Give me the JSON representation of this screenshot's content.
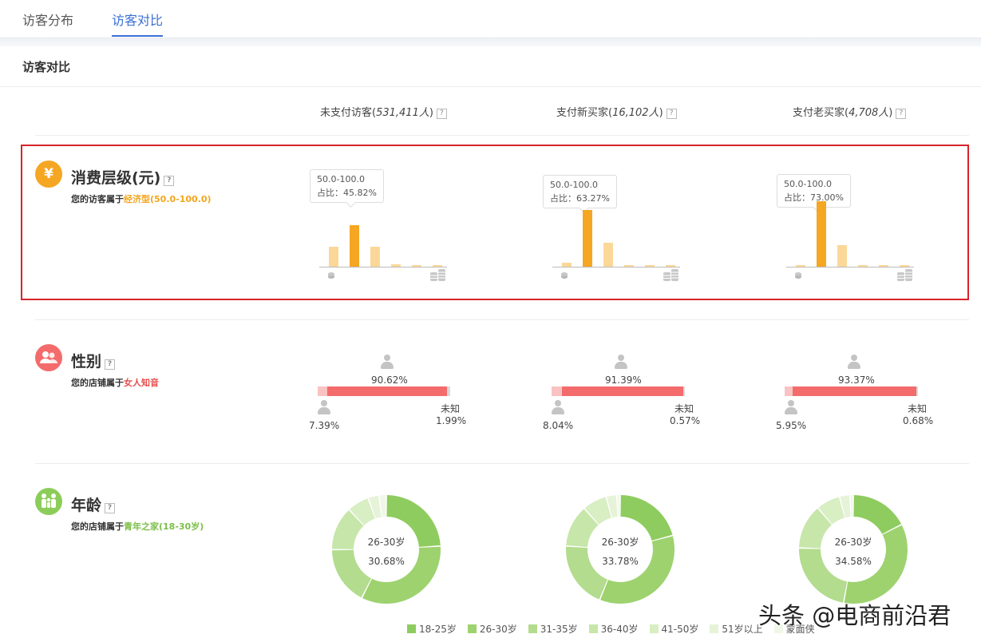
{
  "tabs": [
    {
      "label": "访客分布",
      "active": false
    },
    {
      "label": "访客对比",
      "active": true
    }
  ],
  "section_title": "访客对比",
  "columns": [
    {
      "label": "未支付访客(",
      "count": "531,411人",
      "close": ")"
    },
    {
      "label": "支付新买家(",
      "count": "16,102人",
      "close": ")"
    },
    {
      "label": "支付老买家(",
      "count": "4,708人",
      "close": ")"
    }
  ],
  "help_icon": "?",
  "consumption": {
    "icon": "¥",
    "title": "消费层级(元)",
    "desc_prefix": "您的访客属于",
    "desc_highlight": "经济型(50.0-100.0)",
    "charts": [
      {
        "tooltip_range": "50.0-100.0",
        "tooltip_share": "占比：45.82%",
        "values": [
          0.22,
          0.4582,
          0.22,
          0.03,
          0.01,
          0.01
        ]
      },
      {
        "tooltip_range": "50.0-100.0",
        "tooltip_share": "占比：63.27%",
        "values": [
          0.04,
          0.6327,
          0.27,
          0.02,
          0.01,
          0.01
        ]
      },
      {
        "tooltip_range": "50.0-100.0",
        "tooltip_share": "占比：73.00%",
        "values": [
          0.02,
          0.73,
          0.24,
          0.02,
          0.01,
          0.01
        ]
      }
    ],
    "colors": {
      "highlight": "#f5a623",
      "normal": "#fbd898"
    }
  },
  "gender": {
    "title": "性别",
    "desc_prefix": "您的店铺属于",
    "desc_highlight": "女人知音",
    "unknown_label": "未知",
    "columns": [
      {
        "female": "90.62%",
        "male": "7.39%",
        "unknown": "1.99%",
        "female_frac": 0.9062,
        "male_frac": 0.0739,
        "unknown_frac": 0.0199
      },
      {
        "female": "91.39%",
        "male": "8.04%",
        "unknown": "0.57%",
        "female_frac": 0.9139,
        "male_frac": 0.0804,
        "unknown_frac": 0.0057
      },
      {
        "female": "93.37%",
        "male": "5.95%",
        "unknown": "0.68%",
        "female_frac": 0.9337,
        "male_frac": 0.0595,
        "unknown_frac": 0.0068
      }
    ],
    "colors": {
      "female": "#f46b6b",
      "male": "#f9c3c3",
      "unknown": "#d9d9d9"
    }
  },
  "age": {
    "title": "年龄",
    "desc_prefix": "您的店铺属于",
    "desc_highlight": "青年之家(18-30岁)",
    "charts": [
      {
        "center_label": "26-30岁",
        "center_value": "30.68%",
        "values": [
          0.22,
          0.3068,
          0.16,
          0.12,
          0.06,
          0.03,
          0.02
        ]
      },
      {
        "center_label": "26-30岁",
        "center_value": "33.78%",
        "values": [
          0.2,
          0.3378,
          0.19,
          0.12,
          0.07,
          0.03,
          0.01
        ]
      },
      {
        "center_label": "26-30岁",
        "center_value": "34.58%",
        "values": [
          0.17,
          0.3458,
          0.22,
          0.13,
          0.07,
          0.03,
          0.01
        ]
      }
    ],
    "legend": [
      "18-25岁",
      "26-30岁",
      "31-35岁",
      "36-40岁",
      "41-50岁",
      "51岁以上",
      "蒙面侠"
    ],
    "colors": [
      "#8fcc5f",
      "#9ed26f",
      "#b3dc8e",
      "#c7e6aa",
      "#d8eec3",
      "#e6f3d9",
      "#f0f7e8"
    ]
  },
  "watermark": "头条 @电商前沿君"
}
